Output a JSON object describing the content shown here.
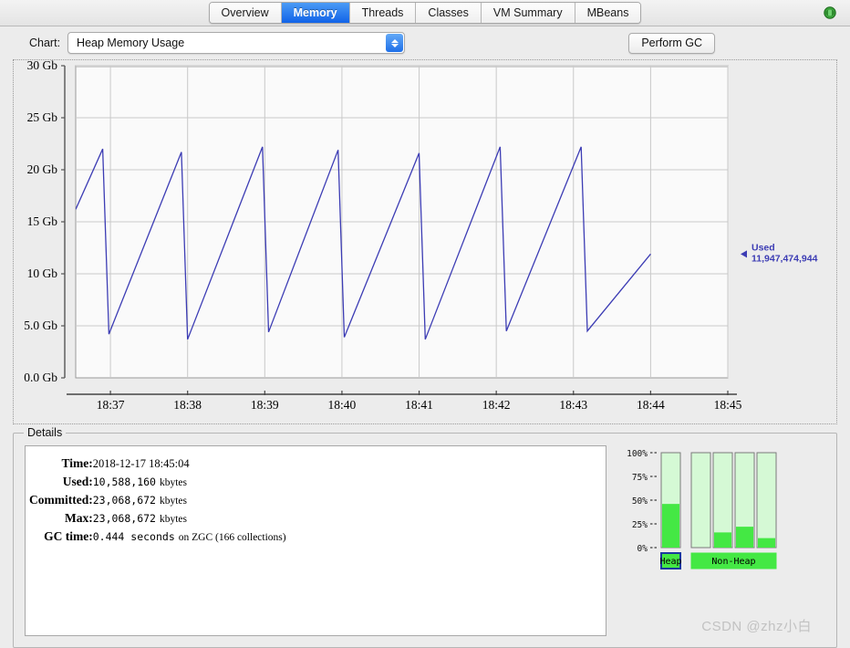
{
  "window": {
    "corner_icon": "expand-collapse-icon"
  },
  "tabs": [
    {
      "label": "Overview",
      "active": false
    },
    {
      "label": "Memory",
      "active": true
    },
    {
      "label": "Threads",
      "active": false
    },
    {
      "label": "Classes",
      "active": false
    },
    {
      "label": "VM Summary",
      "active": false
    },
    {
      "label": "MBeans",
      "active": false
    }
  ],
  "toolbar": {
    "chart_label": "Chart:",
    "chart_selected": "Heap Memory Usage",
    "chart_options": [
      "Heap Memory Usage"
    ],
    "perform_gc_label": "Perform GC"
  },
  "details": {
    "title": "Details",
    "rows": [
      {
        "key": "Time:",
        "value": "2018-12-17 18:45:04",
        "unit": "",
        "style": "serif"
      },
      {
        "key": "Used:",
        "value": "10,588,160",
        "unit": "kbytes",
        "style": "mono"
      },
      {
        "key": "Committed:",
        "value": "23,068,672",
        "unit": "kbytes",
        "style": "mono"
      },
      {
        "key": "Max:",
        "value": "23,068,672",
        "unit": "kbytes",
        "style": "mono"
      },
      {
        "key": "GC time:",
        "value": "0.444  seconds",
        "unit": "on ZGC (166 collections)",
        "style": "mono"
      }
    ]
  },
  "watermark": "CSDN @zhz小白",
  "chart_data": [
    {
      "id": "heap-memory-usage-timeseries",
      "type": "line",
      "title": "Heap Memory Usage",
      "xlabel": "",
      "ylabel": "",
      "line_color": "#3c3cb4",
      "plot_bg": "#fafafa",
      "grid": true,
      "grid_color": "#c9c9c9",
      "ylim": [
        0,
        30
      ],
      "yunit": "Gb",
      "ytick_labels": [
        "0.0 Gb",
        "5.0 Gb",
        "10 Gb",
        "15 Gb",
        "20 Gb",
        "25 Gb",
        "30 Gb"
      ],
      "ytick_values": [
        0,
        5,
        10,
        15,
        20,
        25,
        30
      ],
      "xtick_labels": [
        "18:37",
        "18:38",
        "18:39",
        "18:40",
        "18:41",
        "18:42",
        "18:43",
        "18:44",
        "18:45"
      ],
      "xlim": [
        36.55,
        45.0
      ],
      "legend": {
        "name": "Used",
        "value": "11,947,474,944",
        "color": "#3c3cb4",
        "position": "right-outside",
        "marker": "left-triangle"
      },
      "series": [
        {
          "name": "Used",
          "points": [
            [
              36.55,
              16.2
            ],
            [
              36.9,
              22.0
            ],
            [
              36.98,
              4.2
            ],
            [
              37.92,
              21.7
            ],
            [
              38.0,
              3.7
            ],
            [
              38.97,
              22.2
            ],
            [
              39.05,
              4.4
            ],
            [
              39.95,
              21.9
            ],
            [
              40.03,
              3.9
            ],
            [
              41.0,
              21.6
            ],
            [
              41.08,
              3.7
            ],
            [
              42.05,
              22.2
            ],
            [
              42.13,
              4.5
            ],
            [
              43.1,
              22.2
            ],
            [
              43.18,
              4.5
            ],
            [
              44.0,
              11.9
            ]
          ]
        }
      ]
    },
    {
      "id": "memory-pool-bars",
      "type": "bar",
      "title": "",
      "ylim": [
        0,
        100
      ],
      "yunit": "%",
      "ytick_labels": [
        "0%",
        "25%",
        "50%",
        "75%",
        "100%"
      ],
      "ytick_values": [
        0,
        25,
        50,
        75,
        100
      ],
      "bar_fill_used": "#44e844",
      "bar_fill_empty": "#d5f9d5",
      "bar_border": "#7a7a7a",
      "groups": [
        {
          "label": "Heap",
          "selected": true,
          "bars": [
            {
              "value": 46
            }
          ]
        },
        {
          "label": "Non-Heap",
          "selected": false,
          "bars": [
            {
              "value": 0
            },
            {
              "value": 16
            },
            {
              "value": 22
            },
            {
              "value": 10
            }
          ]
        }
      ]
    }
  ]
}
